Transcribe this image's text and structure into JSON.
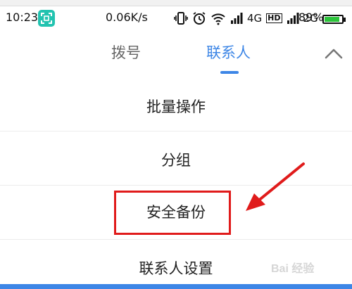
{
  "status_bar": {
    "time": "10:23",
    "net_speed": "0.06K/s",
    "network_4g": "4G",
    "hd_badge": "HD",
    "network_2g": "2G",
    "battery_percent": "89%",
    "battery_level": 0.89,
    "scan_icon_color": "#22c3b0"
  },
  "tabs": {
    "dial": "拨号",
    "contacts": "联系人",
    "active_color": "#3d86e6"
  },
  "menu": {
    "items": [
      "批量操作",
      "分组",
      "安全备份",
      "联系人设置"
    ]
  },
  "annotation": {
    "color": "#e01b1b"
  },
  "watermark": "Bai 经验"
}
